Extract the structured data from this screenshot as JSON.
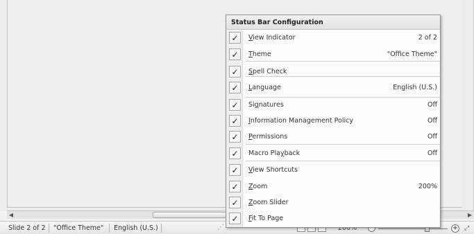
{
  "statusbar": {
    "slide": "Slide 2 of 2",
    "theme": "\"Office Theme\"",
    "language": "English (U.S.)",
    "zoom": "200%",
    "zoom_minus": "−",
    "zoom_plus": "+",
    "fit": "⤢"
  },
  "scrollbar": {
    "left_arrow": "◀",
    "right_arrow": "▶"
  },
  "menu": {
    "title": "Status Bar Configuration",
    "check_glyph": "✓",
    "items": [
      {
        "accel": "V",
        "rest": "iew Indicator",
        "prefix": "",
        "value": "2 of 2",
        "checked": true
      },
      {
        "accel": "T",
        "rest": "heme",
        "prefix": "",
        "value": "\"Office Theme\"",
        "checked": true
      },
      {
        "accel": "S",
        "rest": "pell Check",
        "prefix": "",
        "value": "",
        "checked": true
      },
      {
        "accel": "L",
        "rest": "anguage",
        "prefix": "",
        "value": "English (U.S.)",
        "checked": true
      },
      {
        "accel": "g",
        "rest": "natures",
        "prefix": "Si",
        "value": "Off",
        "checked": true
      },
      {
        "accel": "I",
        "rest": "nformation Management Policy",
        "prefix": "",
        "value": "Off",
        "checked": true
      },
      {
        "accel": "P",
        "rest": "ermissions",
        "prefix": "",
        "value": "Off",
        "checked": true
      },
      {
        "accel": "y",
        "rest": "back",
        "prefix": "Macro Pla",
        "value": "Off",
        "checked": true
      },
      {
        "accel": "V",
        "rest": "iew Shortcuts",
        "prefix": "",
        "value": "",
        "checked": true
      },
      {
        "accel": "Z",
        "rest": "oom",
        "prefix": "",
        "value": "200%",
        "checked": true
      },
      {
        "accel": "Z",
        "rest": "oom Slider",
        "prefix": "",
        "value": "",
        "checked": true
      },
      {
        "accel": "F",
        "rest": "it To Page",
        "prefix": "",
        "value": "",
        "checked": true
      }
    ]
  }
}
